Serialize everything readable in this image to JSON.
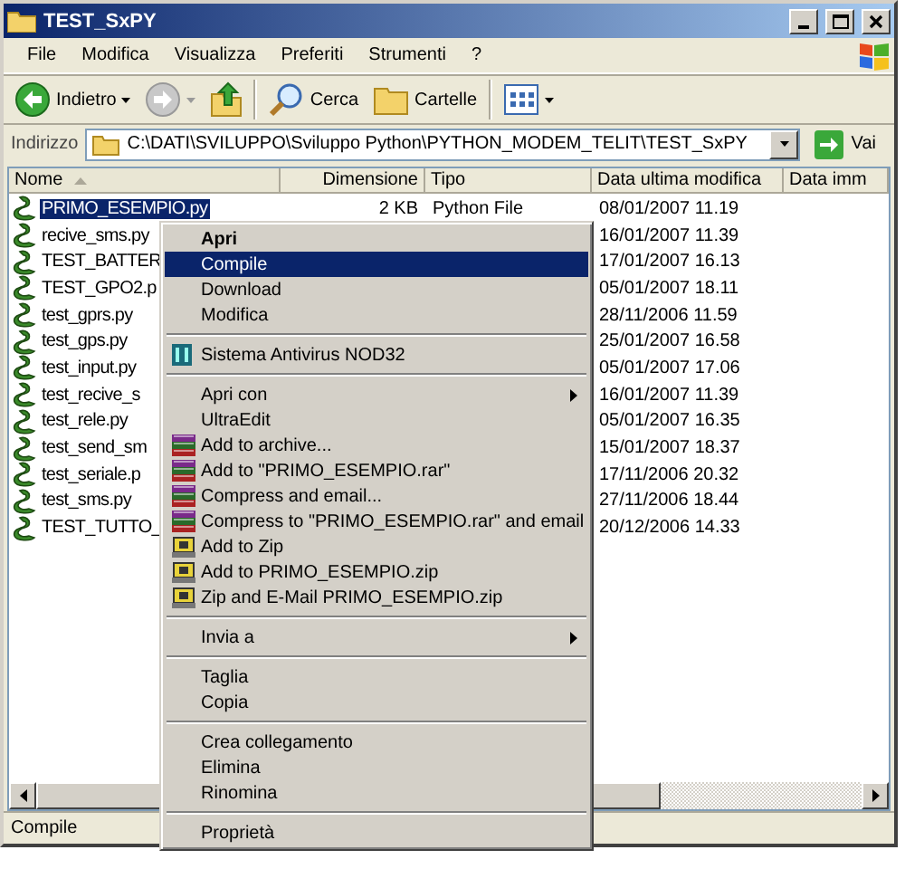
{
  "window": {
    "title": "TEST_SxPY"
  },
  "menu": [
    "File",
    "Modifica",
    "Visualizza",
    "Preferiti",
    "Strumenti",
    "?"
  ],
  "toolbar": {
    "back": "Indietro",
    "search": "Cerca",
    "folders": "Cartelle"
  },
  "address": {
    "label": "Indirizzo",
    "value": "C:\\DATI\\SVILUPPO\\Sviluppo Python\\PYTHON_MODEM_TELIT\\TEST_SxPY",
    "go": "Vai"
  },
  "columns": [
    {
      "label": "Nome",
      "sorted": true
    },
    {
      "label": "Dimensione",
      "sorted": false
    },
    {
      "label": "Tipo",
      "sorted": false
    },
    {
      "label": "Data ultima modifica",
      "sorted": false
    },
    {
      "label": "Data imm",
      "sorted": false
    }
  ],
  "files": [
    {
      "name": "PRIMO_ESEMPIO.py",
      "size": "2 KB",
      "type": "Python File",
      "modified": "08/01/2007 11.19",
      "selected": true
    },
    {
      "name": "recive_sms.py",
      "modified": "16/01/2007 11.39",
      "selected": false
    },
    {
      "name": "TEST_BATTER",
      "modified": "17/01/2007 16.13",
      "selected": false
    },
    {
      "name": "TEST_GPO2.p",
      "modified": "05/01/2007 18.11",
      "selected": false
    },
    {
      "name": "test_gprs.py",
      "modified": "28/11/2006 11.59",
      "selected": false
    },
    {
      "name": "test_gps.py",
      "modified": "25/01/2007 16.58",
      "selected": false
    },
    {
      "name": "test_input.py",
      "modified": "05/01/2007 17.06",
      "selected": false
    },
    {
      "name": "test_recive_s",
      "modified": "16/01/2007 11.39",
      "selected": false
    },
    {
      "name": "test_rele.py",
      "modified": "05/01/2007 16.35",
      "selected": false
    },
    {
      "name": "test_send_sm",
      "modified": "15/01/2007 18.37",
      "selected": false
    },
    {
      "name": "test_seriale.p",
      "modified": "17/11/2006 20.32",
      "selected": false
    },
    {
      "name": "test_sms.py",
      "modified": "27/11/2006 18.44",
      "selected": false
    },
    {
      "name": "TEST_TUTTO_",
      "modified": "20/12/2006 14.33",
      "selected": false
    }
  ],
  "context_menu": [
    {
      "kind": "item",
      "label": "Apri",
      "default": true,
      "selected": false
    },
    {
      "kind": "item",
      "label": "Compile",
      "default": false,
      "selected": true
    },
    {
      "kind": "item",
      "label": "Download",
      "default": false,
      "selected": false
    },
    {
      "kind": "item",
      "label": "Modifica",
      "default": false,
      "selected": false
    },
    {
      "kind": "separator"
    },
    {
      "kind": "scanner",
      "label": "Sistema Antivirus NOD32",
      "default": false,
      "selected": false
    },
    {
      "kind": "separator"
    },
    {
      "kind": "submenu",
      "label": "Apri con",
      "default": false,
      "selected": false
    },
    {
      "kind": "item",
      "label": "UltraEdit",
      "default": false,
      "selected": false
    },
    {
      "kind": "archive",
      "label": "Add to archive...",
      "default": false,
      "selected": false
    },
    {
      "kind": "archive",
      "label": "Add to \"PRIMO_ESEMPIO.rar\"",
      "default": false,
      "selected": false
    },
    {
      "kind": "archive",
      "label": "Compress and email...",
      "default": false,
      "selected": false
    },
    {
      "kind": "archive",
      "label": "Compress to \"PRIMO_ESEMPIO.rar\" and email",
      "default": false,
      "selected": false
    },
    {
      "kind": "zip",
      "label": "Add to Zip",
      "default": false,
      "selected": false
    },
    {
      "kind": "zip",
      "label": "Add to PRIMO_ESEMPIO.zip",
      "default": false,
      "selected": false
    },
    {
      "kind": "zip",
      "label": "Zip and E-Mail PRIMO_ESEMPIO.zip",
      "default": false,
      "selected": false
    },
    {
      "kind": "separator"
    },
    {
      "kind": "submenu",
      "label": "Invia a",
      "default": false,
      "selected": false
    },
    {
      "kind": "separator"
    },
    {
      "kind": "item",
      "label": "Taglia",
      "default": false,
      "selected": false
    },
    {
      "kind": "item",
      "label": "Copia",
      "default": false,
      "selected": false
    },
    {
      "kind": "separator"
    },
    {
      "kind": "item",
      "label": "Crea collegamento",
      "default": false,
      "selected": false
    },
    {
      "kind": "item",
      "label": "Elimina",
      "default": false,
      "selected": false
    },
    {
      "kind": "item",
      "label": "Rinomina",
      "default": false,
      "selected": false
    },
    {
      "kind": "separator"
    },
    {
      "kind": "item",
      "label": "Proprietà",
      "default": false,
      "selected": false
    }
  ],
  "status_bar": "Compile"
}
